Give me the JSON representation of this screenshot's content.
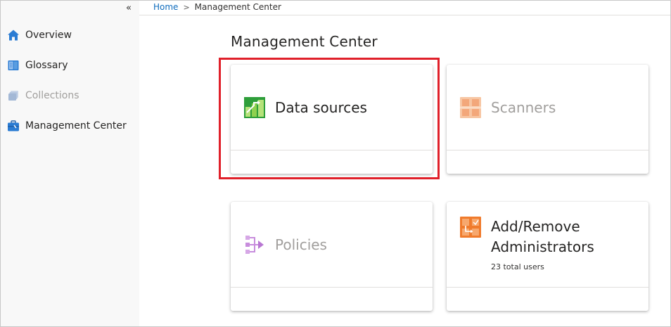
{
  "sidebar": {
    "collapse_glyph": "«",
    "items": [
      {
        "label": "Overview",
        "icon": "home-icon",
        "enabled": true
      },
      {
        "label": "Glossary",
        "icon": "book-icon",
        "enabled": true
      },
      {
        "label": "Collections",
        "icon": "collections-icon",
        "enabled": false
      },
      {
        "label": "Management Center",
        "icon": "toolbox-icon",
        "enabled": true
      }
    ]
  },
  "breadcrumb": {
    "home": "Home",
    "separator": ">",
    "current": "Management Center"
  },
  "page": {
    "title": "Management Center"
  },
  "cards": [
    {
      "title": "Data sources",
      "icon": "data-sources-icon",
      "enabled": true,
      "highlighted": true
    },
    {
      "title": "Scanners",
      "icon": "scanners-icon",
      "enabled": false
    },
    {
      "title": "Policies",
      "icon": "policies-icon",
      "enabled": false
    },
    {
      "title_line1": "Add/Remove",
      "title_line2": "Administrators",
      "subtitle": "23 total users",
      "icon": "administrators-icon",
      "enabled": true
    }
  ],
  "colors": {
    "highlight": "#e0202a",
    "link": "#0f6cbd",
    "accent_green": "#2e9e3a",
    "accent_orange": "#f07b2c"
  }
}
